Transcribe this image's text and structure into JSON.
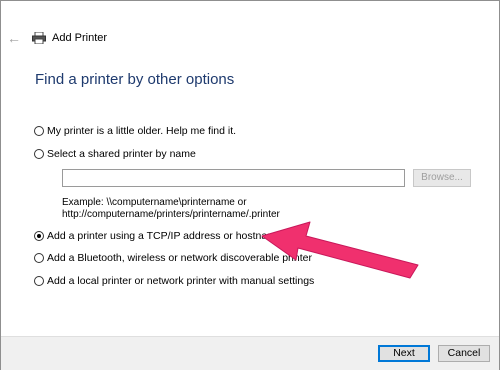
{
  "window": {
    "title": "Add Printer"
  },
  "heading": "Find a printer by other options",
  "options": [
    {
      "label": "My printer is a little older. Help me find it.",
      "checked": false
    },
    {
      "label": "Select a shared printer by name",
      "checked": false
    },
    {
      "label": "Add a printer using a TCP/IP address or hostname",
      "checked": true
    },
    {
      "label": "Add a Bluetooth, wireless or network discoverable printer",
      "checked": false
    },
    {
      "label": "Add a local printer or network printer with manual settings",
      "checked": false
    }
  ],
  "shared_name": {
    "value": "",
    "browse_label": "Browse...",
    "example_line1": "Example: \\\\computername\\printername or",
    "example_line2": "http://computername/printers/printername/.printer"
  },
  "buttons": {
    "next": "Next",
    "cancel": "Cancel"
  },
  "icons": {
    "back": "back-arrow-icon",
    "printer": "printer-icon"
  },
  "colors": {
    "heading": "#1e3a6e",
    "annotation_arrow": "#f0306e",
    "default_button_border": "#0078d7"
  }
}
